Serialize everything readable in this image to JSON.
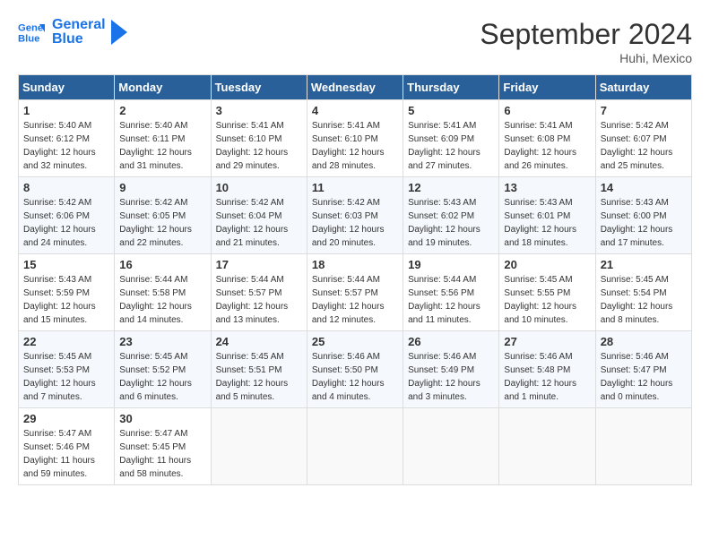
{
  "header": {
    "logo_line1": "General",
    "logo_line2": "Blue",
    "month": "September 2024",
    "location": "Huhi, Mexico"
  },
  "days_of_week": [
    "Sunday",
    "Monday",
    "Tuesday",
    "Wednesday",
    "Thursday",
    "Friday",
    "Saturday"
  ],
  "weeks": [
    [
      {
        "day": "1",
        "info": "Sunrise: 5:40 AM\nSunset: 6:12 PM\nDaylight: 12 hours\nand 32 minutes."
      },
      {
        "day": "2",
        "info": "Sunrise: 5:40 AM\nSunset: 6:11 PM\nDaylight: 12 hours\nand 31 minutes."
      },
      {
        "day": "3",
        "info": "Sunrise: 5:41 AM\nSunset: 6:10 PM\nDaylight: 12 hours\nand 29 minutes."
      },
      {
        "day": "4",
        "info": "Sunrise: 5:41 AM\nSunset: 6:10 PM\nDaylight: 12 hours\nand 28 minutes."
      },
      {
        "day": "5",
        "info": "Sunrise: 5:41 AM\nSunset: 6:09 PM\nDaylight: 12 hours\nand 27 minutes."
      },
      {
        "day": "6",
        "info": "Sunrise: 5:41 AM\nSunset: 6:08 PM\nDaylight: 12 hours\nand 26 minutes."
      },
      {
        "day": "7",
        "info": "Sunrise: 5:42 AM\nSunset: 6:07 PM\nDaylight: 12 hours\nand 25 minutes."
      }
    ],
    [
      {
        "day": "8",
        "info": "Sunrise: 5:42 AM\nSunset: 6:06 PM\nDaylight: 12 hours\nand 24 minutes."
      },
      {
        "day": "9",
        "info": "Sunrise: 5:42 AM\nSunset: 6:05 PM\nDaylight: 12 hours\nand 22 minutes."
      },
      {
        "day": "10",
        "info": "Sunrise: 5:42 AM\nSunset: 6:04 PM\nDaylight: 12 hours\nand 21 minutes."
      },
      {
        "day": "11",
        "info": "Sunrise: 5:42 AM\nSunset: 6:03 PM\nDaylight: 12 hours\nand 20 minutes."
      },
      {
        "day": "12",
        "info": "Sunrise: 5:43 AM\nSunset: 6:02 PM\nDaylight: 12 hours\nand 19 minutes."
      },
      {
        "day": "13",
        "info": "Sunrise: 5:43 AM\nSunset: 6:01 PM\nDaylight: 12 hours\nand 18 minutes."
      },
      {
        "day": "14",
        "info": "Sunrise: 5:43 AM\nSunset: 6:00 PM\nDaylight: 12 hours\nand 17 minutes."
      }
    ],
    [
      {
        "day": "15",
        "info": "Sunrise: 5:43 AM\nSunset: 5:59 PM\nDaylight: 12 hours\nand 15 minutes."
      },
      {
        "day": "16",
        "info": "Sunrise: 5:44 AM\nSunset: 5:58 PM\nDaylight: 12 hours\nand 14 minutes."
      },
      {
        "day": "17",
        "info": "Sunrise: 5:44 AM\nSunset: 5:57 PM\nDaylight: 12 hours\nand 13 minutes."
      },
      {
        "day": "18",
        "info": "Sunrise: 5:44 AM\nSunset: 5:57 PM\nDaylight: 12 hours\nand 12 minutes."
      },
      {
        "day": "19",
        "info": "Sunrise: 5:44 AM\nSunset: 5:56 PM\nDaylight: 12 hours\nand 11 minutes."
      },
      {
        "day": "20",
        "info": "Sunrise: 5:45 AM\nSunset: 5:55 PM\nDaylight: 12 hours\nand 10 minutes."
      },
      {
        "day": "21",
        "info": "Sunrise: 5:45 AM\nSunset: 5:54 PM\nDaylight: 12 hours\nand 8 minutes."
      }
    ],
    [
      {
        "day": "22",
        "info": "Sunrise: 5:45 AM\nSunset: 5:53 PM\nDaylight: 12 hours\nand 7 minutes."
      },
      {
        "day": "23",
        "info": "Sunrise: 5:45 AM\nSunset: 5:52 PM\nDaylight: 12 hours\nand 6 minutes."
      },
      {
        "day": "24",
        "info": "Sunrise: 5:45 AM\nSunset: 5:51 PM\nDaylight: 12 hours\nand 5 minutes."
      },
      {
        "day": "25",
        "info": "Sunrise: 5:46 AM\nSunset: 5:50 PM\nDaylight: 12 hours\nand 4 minutes."
      },
      {
        "day": "26",
        "info": "Sunrise: 5:46 AM\nSunset: 5:49 PM\nDaylight: 12 hours\nand 3 minutes."
      },
      {
        "day": "27",
        "info": "Sunrise: 5:46 AM\nSunset: 5:48 PM\nDaylight: 12 hours\nand 1 minute."
      },
      {
        "day": "28",
        "info": "Sunrise: 5:46 AM\nSunset: 5:47 PM\nDaylight: 12 hours\nand 0 minutes."
      }
    ],
    [
      {
        "day": "29",
        "info": "Sunrise: 5:47 AM\nSunset: 5:46 PM\nDaylight: 11 hours\nand 59 minutes."
      },
      {
        "day": "30",
        "info": "Sunrise: 5:47 AM\nSunset: 5:45 PM\nDaylight: 11 hours\nand 58 minutes."
      },
      {
        "day": "",
        "info": ""
      },
      {
        "day": "",
        "info": ""
      },
      {
        "day": "",
        "info": ""
      },
      {
        "day": "",
        "info": ""
      },
      {
        "day": "",
        "info": ""
      }
    ]
  ]
}
